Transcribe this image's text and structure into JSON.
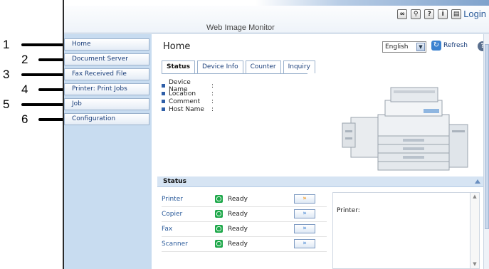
{
  "callouts": [
    "1",
    "2",
    "3",
    "4",
    "5",
    "6"
  ],
  "header": {
    "title": "Web Image Monitor",
    "icons": [
      "link-icon",
      "search-icon",
      "help-icon",
      "info-icon",
      "login-icon"
    ],
    "login_label": "Login"
  },
  "sidebar": {
    "items": [
      {
        "label": "Home"
      },
      {
        "label": "Document Server"
      },
      {
        "label": "Fax Received File"
      },
      {
        "label": "Printer: Print Jobs"
      },
      {
        "label": "Job"
      },
      {
        "label": "Configuration"
      }
    ]
  },
  "main": {
    "title": "Home",
    "language": "English",
    "refresh_label": "Refresh",
    "tabs": [
      {
        "label": "Status",
        "active": true
      },
      {
        "label": "Device Info",
        "active": false
      },
      {
        "label": "Counter",
        "active": false
      },
      {
        "label": "Inquiry",
        "active": false
      }
    ],
    "info": [
      {
        "label": "Device Name",
        "sep": ":"
      },
      {
        "label": "Location",
        "sep": ":"
      },
      {
        "label": "Comment",
        "sep": ":"
      },
      {
        "label": "Host Name",
        "sep": ":"
      }
    ]
  },
  "status": {
    "title": "Status",
    "rows": [
      {
        "device": "Printer",
        "state": "Ready"
      },
      {
        "device": "Copier",
        "state": "Ready"
      },
      {
        "device": "Fax",
        "state": "Ready"
      },
      {
        "device": "Scanner",
        "state": "Ready"
      }
    ],
    "detail_label": "Printer:"
  },
  "colors": {
    "sidebar_bg": "#c8dcf0",
    "link": "#1a3e7a",
    "ready_green": "#1ea84a",
    "status_header": "#d6e4f3"
  }
}
